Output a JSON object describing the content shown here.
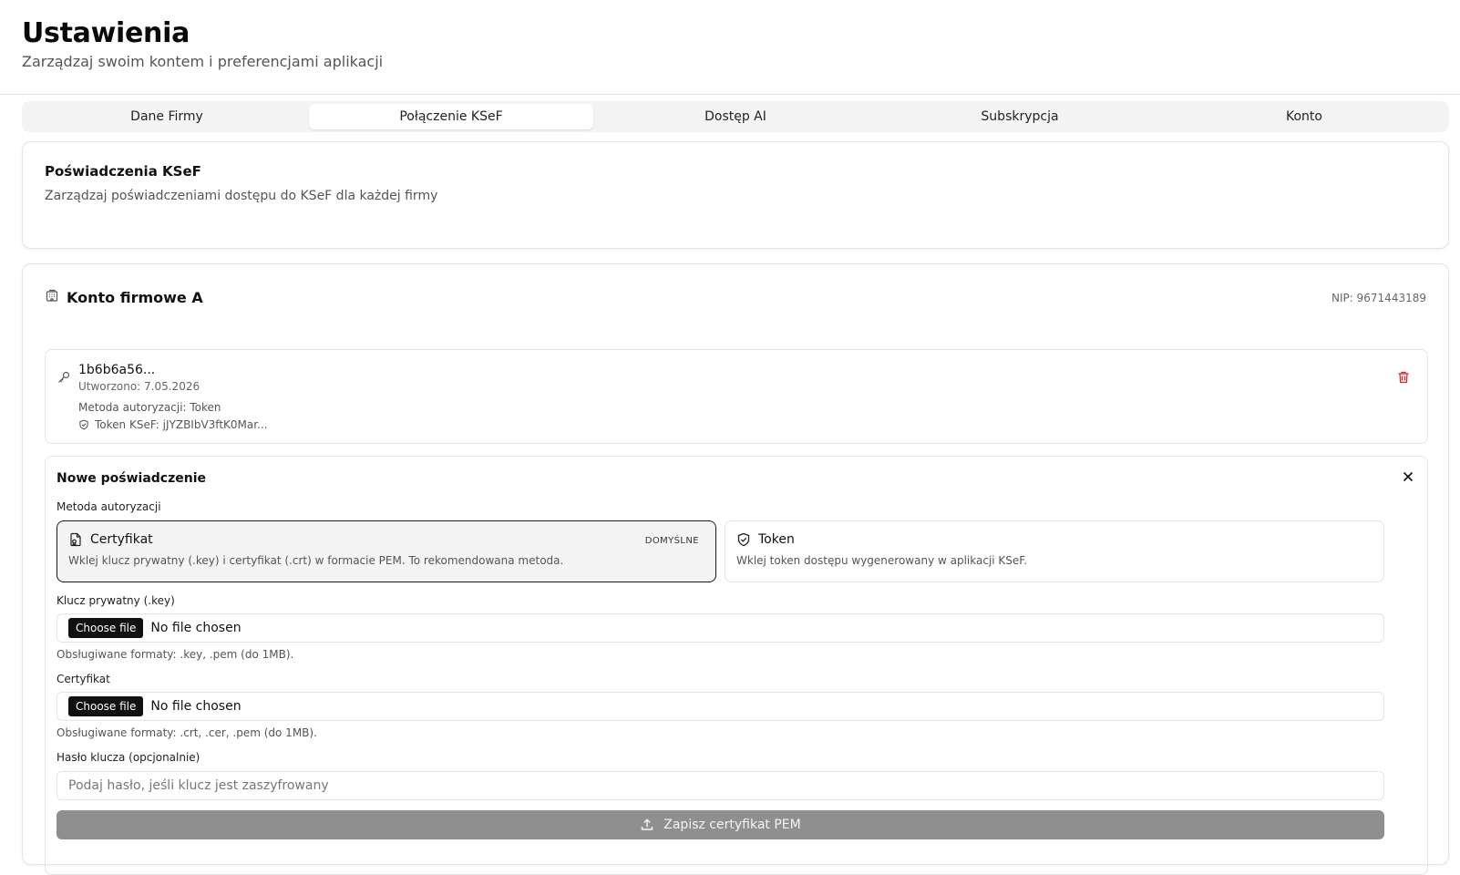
{
  "header": {
    "title": "Ustawienia",
    "subtitle": "Zarządzaj swoim kontem i preferencjami aplikacji"
  },
  "tabs": [
    {
      "label": "Dane Firmy",
      "active": false
    },
    {
      "label": "Połączenie KSeF",
      "active": true
    },
    {
      "label": "Dostęp AI",
      "active": false
    },
    {
      "label": "Subskrypcja",
      "active": false
    },
    {
      "label": "Konto",
      "active": false
    }
  ],
  "credentials_card": {
    "title": "Poświadczenia KSeF",
    "description": "Zarządzaj poświadczeniami dostępu do KSeF dla każdej firmy"
  },
  "company": {
    "name": "Konto firmowe A",
    "nip": "NIP: 9671443189",
    "credential": {
      "id": "1b6b6a56...",
      "created": "Utworzono: 7.05.2026",
      "method": "Metoda autoryzacji:  Token",
      "token": "Token KSeF: jJYZBIbV3ftK0Mar..."
    }
  },
  "new_credential": {
    "title": "Nowe poświadczenie",
    "method_label": "Metoda autoryzacji",
    "options": [
      {
        "title": "Certyfikat",
        "description": "Wklej klucz prywatny (.key) i certyfikat (.crt) w formacie PEM. To rekomendowana metoda.",
        "badge": "DOMYŚLNE",
        "selected": true
      },
      {
        "title": "Token",
        "description": "Wklej token dostępu wygenerowany w aplikacji KSeF.",
        "selected": false
      }
    ],
    "private_key": {
      "label": "Klucz prywatny (.key)",
      "button": "Choose file",
      "status": "No file chosen",
      "hint": "Obsługiwane formaty: .key, .pem (do 1MB)."
    },
    "certificate": {
      "label": "Certyfikat",
      "button": "Choose file",
      "status": "No file chosen",
      "hint": "Obsługiwane formaty: .crt, .cer, .pem (do 1MB)."
    },
    "password": {
      "label": "Hasło klucza (opcjonalnie)",
      "placeholder": "Podaj hasło, jeśli klucz jest zaszyfrowany"
    },
    "save_label": "Zapisz certyfikat PEM"
  }
}
